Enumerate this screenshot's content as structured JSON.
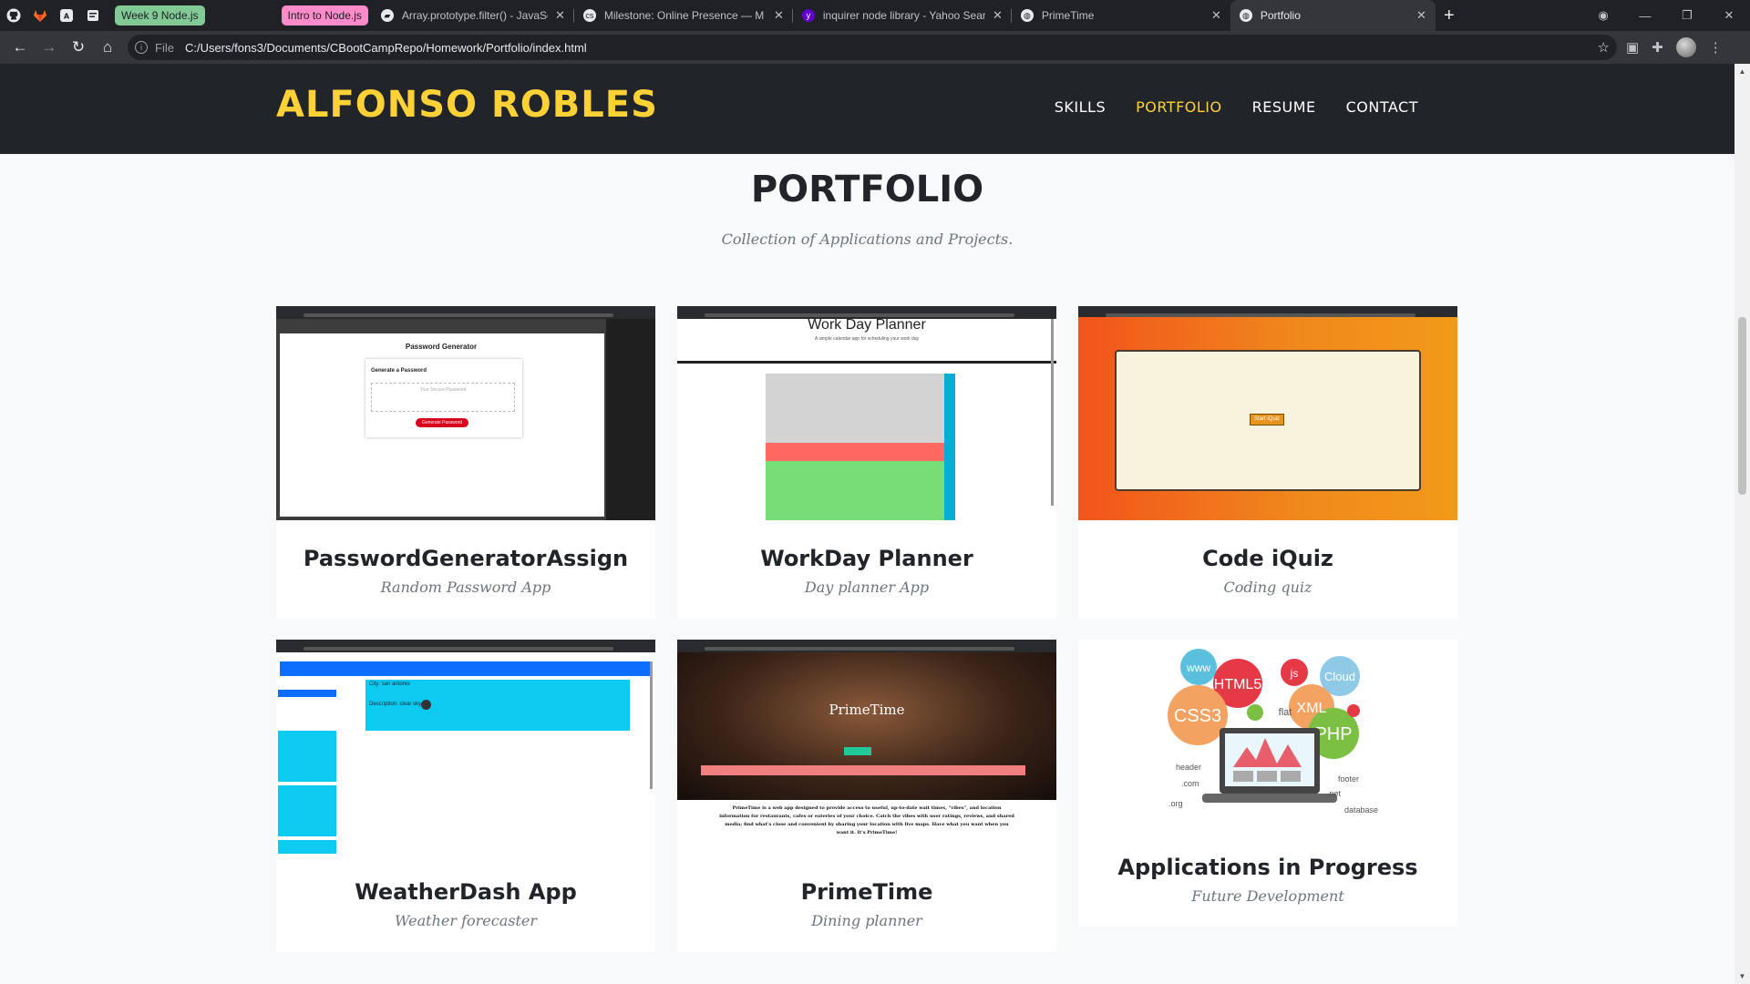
{
  "browser": {
    "pinned": [
      "github-icon",
      "gitlab-icon",
      "codewars-icon",
      "notes-icon"
    ],
    "groups": [
      {
        "label": "Week 9 Node.js",
        "color": "#81c995"
      },
      {
        "label": "Intro to Node.js",
        "color": "#ff8bcb"
      }
    ],
    "tabs": [
      {
        "title": "Array.prototype.filter() - JavaScript",
        "icon": "mdn-icon"
      },
      {
        "title": "Milestone: Online Presence — M",
        "icon": "cs-icon"
      },
      {
        "title": "inquirer node library - Yahoo Search",
        "icon": "yahoo-icon"
      },
      {
        "title": "PrimeTime",
        "icon": "globe-icon"
      },
      {
        "title": "Portfolio",
        "icon": "globe-icon",
        "active": true
      }
    ],
    "url_scheme": "File",
    "url": "C:/Users/fons3/Documents/CBootCampRepo/Homework/Portfolio/index.html"
  },
  "site": {
    "brand": "ALFONSO ROBLES",
    "menu": [
      "SKILLS",
      "PORTFOLIO",
      "RESUME",
      "CONTACT"
    ],
    "active_menu": "PORTFOLIO",
    "accent_color": "#fed136"
  },
  "portfolio": {
    "heading": "PORTFOLIO",
    "subheading": "Collection of Applications and Projects.",
    "items": [
      {
        "title": "PasswordGeneratorAssign",
        "subtitle": "Random Password App",
        "thumb": {
          "heading": "Password Generator",
          "label": "Generate a Password",
          "placeholder": "Your Secure Password",
          "button": "Generate Password"
        }
      },
      {
        "title": "WorkDay Planner",
        "subtitle": "Day planner App",
        "thumb": {
          "heading": "Work Day Planner",
          "tagline": "A simple calendar app for scheduling your work day"
        }
      },
      {
        "title": "Code iQuiz",
        "subtitle": "Coding quiz",
        "thumb": {
          "button": "Start iQuiz"
        }
      },
      {
        "title": "WeatherDash App",
        "subtitle": "Weather forecaster",
        "thumb": {
          "city": "City: san antonio",
          "desc": "Description: clear sky"
        }
      },
      {
        "title": "PrimeTime",
        "subtitle": "Dining planner",
        "thumb": {
          "heading": "PrimeTime",
          "body": "PrimeTime is a web app designed to provide access to useful, up-to-date wait times, \"vibes\", and location information for restaurants, cafes or eateries of your choice. Catch the vibes with user ratings, reviews, and shared media; find what's close and convenient by sharing your location with live maps. Have what you want when you want it. It's PrimeTime!"
        }
      },
      {
        "title": "Applications in Progress",
        "subtitle": "Future Development",
        "thumb": {
          "bubbles": [
            "www",
            "HTML5",
            "js",
            "Cloud",
            "CSS3",
            "XML",
            "flat",
            "PHP"
          ],
          "words": [
            "header",
            ".com",
            ".org",
            "footer",
            ".net",
            "database"
          ]
        }
      }
    ]
  }
}
